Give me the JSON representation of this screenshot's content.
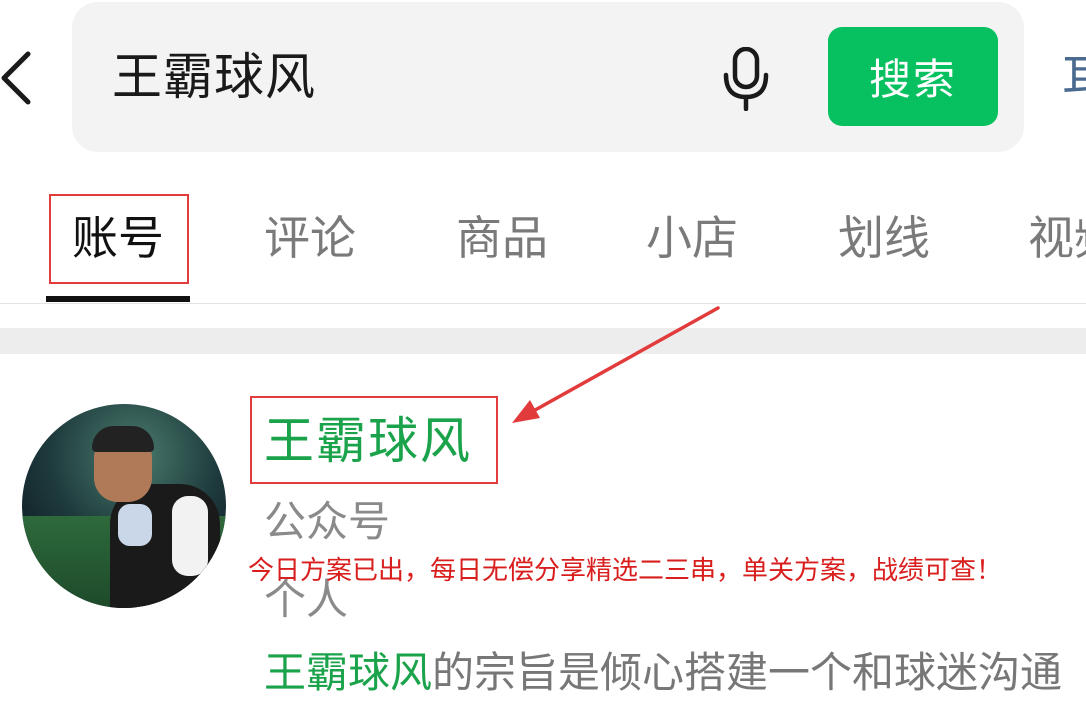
{
  "search": {
    "query": "王霸球风",
    "button_label": "搜索",
    "cancel_label_partial": "耳"
  },
  "tabs": [
    {
      "label": "账号",
      "active": true
    },
    {
      "label": "评论",
      "active": false
    },
    {
      "label": "商品",
      "active": false
    },
    {
      "label": "小店",
      "active": false
    },
    {
      "label": "划线",
      "active": false
    },
    {
      "label": "视频",
      "active": false
    }
  ],
  "result": {
    "name": "王霸球风",
    "type": "公众号",
    "subtype": "个人",
    "desc_highlight": "王霸球风",
    "desc_rest": "的宗旨是倾心搭建一个和球迷沟通"
  },
  "annotation": {
    "text": "今日方案已出，每日无偿分享精选二三串，单关方案，战绩可查！",
    "color": "#d91e1e"
  },
  "colors": {
    "accent_green": "#07c160",
    "name_green": "#1aa34a",
    "annotation_red": "#e23b3b"
  },
  "icons": {
    "back": "chevron-left-icon",
    "mic": "microphone-icon"
  }
}
